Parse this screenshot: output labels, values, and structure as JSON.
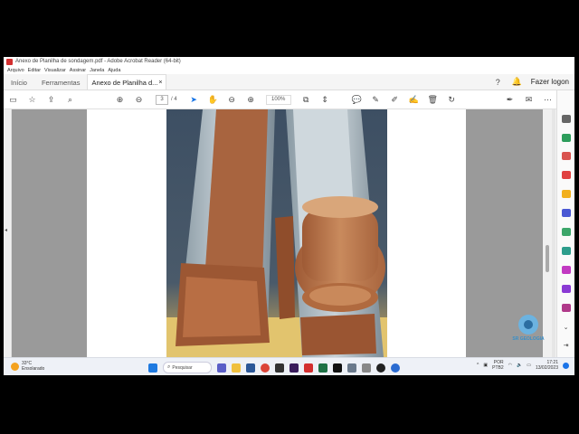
{
  "window": {
    "title": "Anexo de Planilha de sondagem.pdf - Adobe Acrobat Reader (64-bit)"
  },
  "menu": [
    "Arquivo",
    "Editar",
    "Visualizar",
    "Assinar",
    "Janela",
    "Ajuda"
  ],
  "tabs": {
    "home": "Início",
    "tools": "Ferramentas",
    "document": "Anexo de Planilha d..."
  },
  "header": {
    "signin": "Fazer logon"
  },
  "toolbar": {
    "page_current": "3",
    "page_total": "/ 4",
    "zoom": "100%"
  },
  "logo": {
    "text": "SR GEOLOGIA"
  },
  "taskbar": {
    "weather_temp": "33°C",
    "weather_desc": "Ensolarado",
    "search_label": "Pesquisar",
    "language": "POR",
    "layout": "PTB2",
    "time": "17:21",
    "date": "13/02/2023"
  },
  "colors": {
    "accent": "#1473e6",
    "adobe_red": "#d32f2f"
  }
}
